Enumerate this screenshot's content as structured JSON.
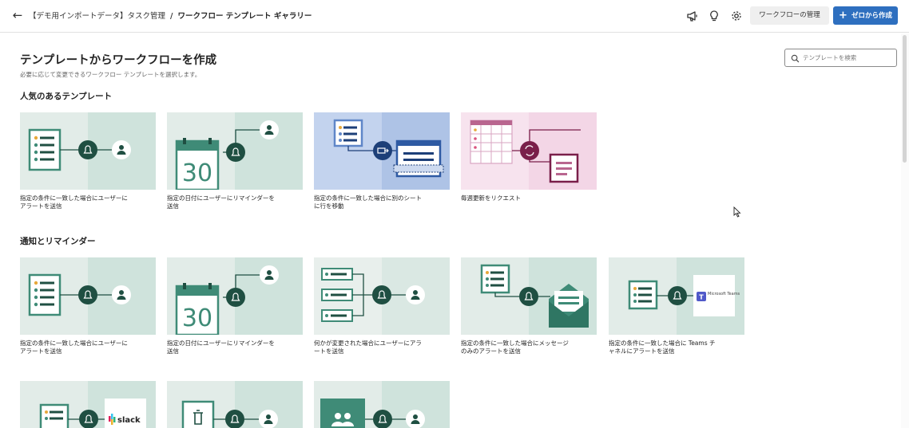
{
  "header": {
    "back_label": "←",
    "breadcrumb_parent": "【デモ用インポートデータ】タスク管理",
    "breadcrumb_sep": "/",
    "breadcrumb_current": "ワークフロー テンプレート ギャラリー",
    "manage_button": "ワークフローの管理",
    "create_button": "ゼロから作成",
    "icons": [
      "megaphone-icon",
      "lightbulb-icon",
      "gear-icon"
    ]
  },
  "page": {
    "title": "テンプレートからワークフローを作成",
    "subtitle": "必要に応じて変更できるワークフロー テンプレートを選択します。",
    "search_placeholder": "テンプレートを検索"
  },
  "sections": {
    "popular": {
      "title": "人気のあるテンプレート",
      "cards": [
        {
          "caption_1": "指定の条件に一致した場合にユーザーに",
          "caption_2": "アラートを送信",
          "art": "list-bell-person"
        },
        {
          "caption_1": "指定の日付にユーザーにリマインダーを",
          "caption_2": "送信",
          "art": "calendar-person",
          "calendar_day": "30"
        },
        {
          "caption_1": "指定の条件に一致した場合に別のシート",
          "caption_2": "に行を移動",
          "art": "move-row"
        },
        {
          "caption_1": "毎週更新をリクエスト",
          "caption_2": "",
          "art": "grid-refresh"
        }
      ]
    },
    "notify": {
      "title": "通知とリマインダー",
      "cards": [
        {
          "caption_1": "指定の条件に一致した場合にユーザーに",
          "caption_2": "アラートを送信",
          "art": "list-bell-person"
        },
        {
          "caption_1": "指定の日付にユーザーにリマインダーを",
          "caption_2": "送信",
          "art": "calendar-person",
          "calendar_day": "30"
        },
        {
          "caption_1": "何かが変更された場合にユーザーにアラ",
          "caption_2": "ートを送信",
          "art": "rows-bell-person"
        },
        {
          "caption_1": "指定の条件に一致した場合にメッセージ",
          "caption_2": "のみのアラートを送信",
          "art": "list-bell-mail"
        },
        {
          "caption_1": "指定の条件に一致した場合に Teams チ",
          "caption_2": "ャネルにアラートを送信",
          "art": "list-bell-teams",
          "brand": "Microsoft Teams"
        }
      ]
    },
    "more": {
      "cards": [
        {
          "art": "list-bell-slack",
          "brand": "slack"
        },
        {
          "art": "trash-bell-person"
        },
        {
          "art": "group-bell-person"
        }
      ]
    }
  },
  "colors": {
    "teal_dark": "#1f4f42",
    "teal_mid": "#3f8b77",
    "teal_light": "#cfe3dc",
    "teal_pale": "#e2ece8",
    "blue_bg": "#aec3e6",
    "blue_dark": "#1d3f78",
    "pink_bg": "#f3d6e6",
    "maroon": "#7a1f4a",
    "primary": "#2e6fbf"
  }
}
